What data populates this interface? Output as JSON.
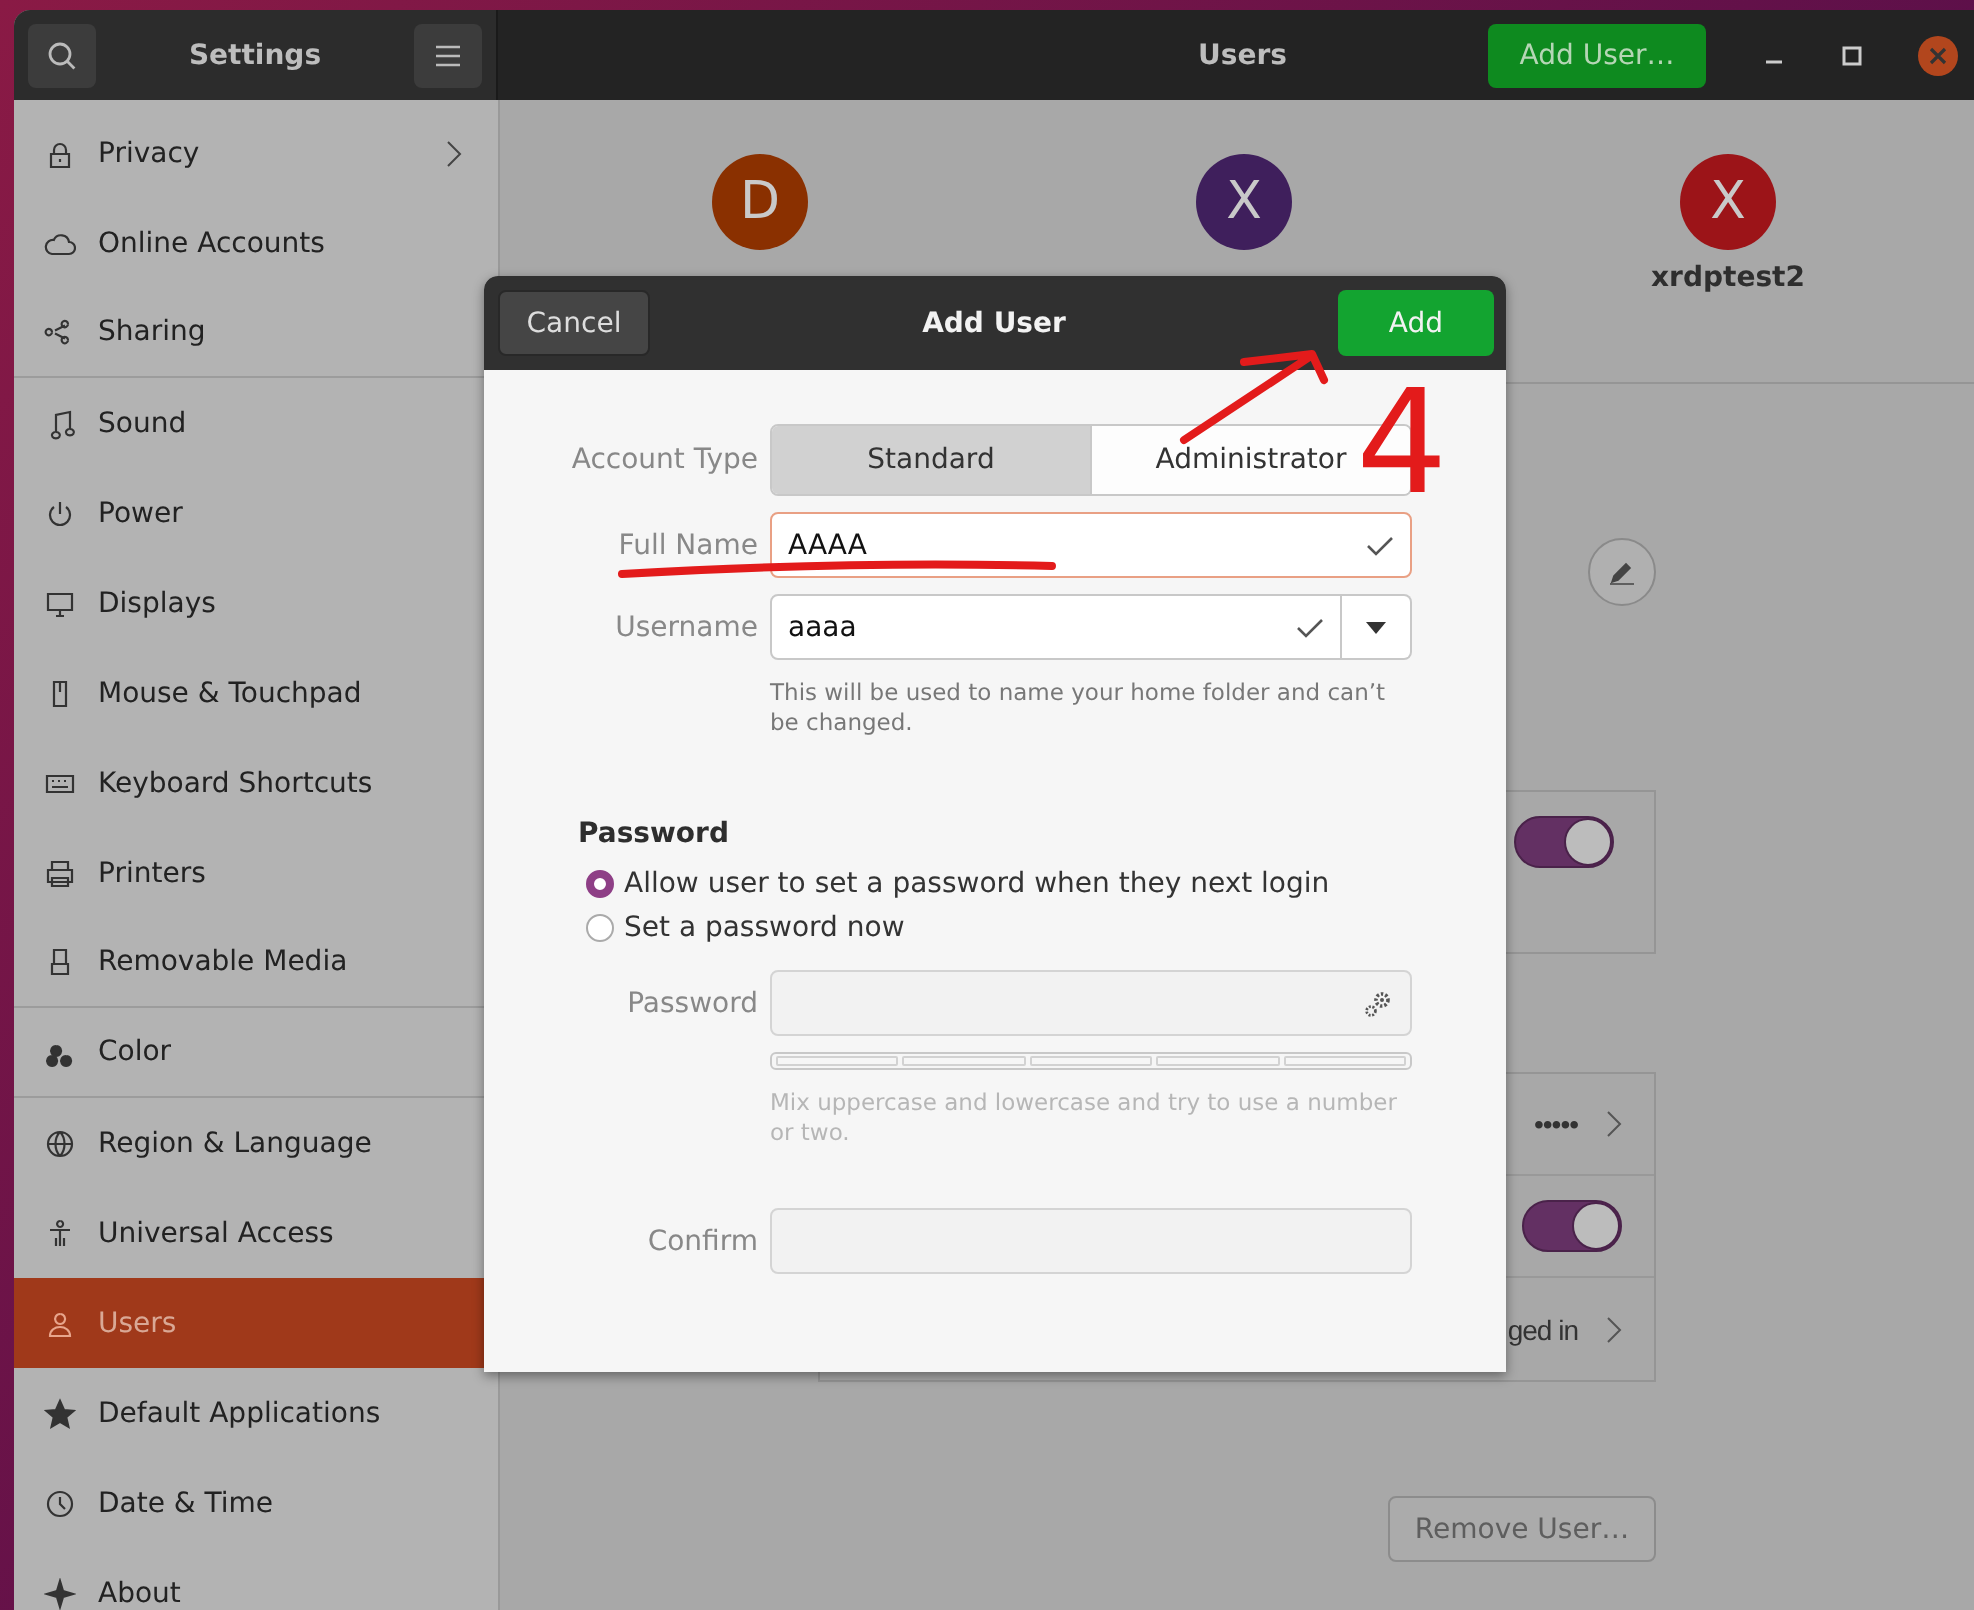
{
  "window": {
    "title": "Settings",
    "page_title": "Users",
    "add_user_button": "Add User…"
  },
  "sidebar": {
    "items": [
      {
        "label": "Privacy",
        "has_submenu": true,
        "group_end": false,
        "selected": false
      },
      {
        "label": "Online Accounts",
        "has_submenu": false,
        "group_end": false,
        "selected": false
      },
      {
        "label": "Sharing",
        "has_submenu": false,
        "group_end": true,
        "selected": false
      },
      {
        "label": "Sound",
        "has_submenu": false,
        "group_end": false,
        "selected": false
      },
      {
        "label": "Power",
        "has_submenu": false,
        "group_end": false,
        "selected": false
      },
      {
        "label": "Displays",
        "has_submenu": false,
        "group_end": false,
        "selected": false
      },
      {
        "label": "Mouse & Touchpad",
        "has_submenu": false,
        "group_end": false,
        "selected": false
      },
      {
        "label": "Keyboard Shortcuts",
        "has_submenu": false,
        "group_end": false,
        "selected": false
      },
      {
        "label": "Printers",
        "has_submenu": false,
        "group_end": false,
        "selected": false
      },
      {
        "label": "Removable Media",
        "has_submenu": false,
        "group_end": true,
        "selected": false
      },
      {
        "label": "Color",
        "has_submenu": false,
        "group_end": true,
        "selected": false
      },
      {
        "label": "Region & Language",
        "has_submenu": false,
        "group_end": false,
        "selected": false
      },
      {
        "label": "Universal Access",
        "has_submenu": false,
        "group_end": false,
        "selected": false
      },
      {
        "label": "Users",
        "has_submenu": false,
        "group_end": false,
        "selected": true
      },
      {
        "label": "Default Applications",
        "has_submenu": false,
        "group_end": false,
        "selected": false
      },
      {
        "label": "Date & Time",
        "has_submenu": false,
        "group_end": false,
        "selected": false
      },
      {
        "label": "About",
        "has_submenu": false,
        "group_end": false,
        "selected": false
      }
    ]
  },
  "users": [
    {
      "initial": "D",
      "color": "#8a3000"
    },
    {
      "initial": "X",
      "color": "#3f1f5c"
    },
    {
      "initial": "X",
      "color": "#9c1418",
      "name": "xrdptest2"
    }
  ],
  "account_panel": {
    "toggle_on": true
  },
  "login_panel": {
    "rows": [
      {
        "kind": "value",
        "text": "•••••"
      },
      {
        "kind": "toggle",
        "on": true
      },
      {
        "kind": "value",
        "text": "ged in"
      }
    ]
  },
  "remove_button": "Remove User…",
  "dialog": {
    "title": "Add User",
    "cancel": "Cancel",
    "confirm": "Add",
    "account_type": {
      "label": "Account Type",
      "options": [
        {
          "label": "Standard",
          "selected": true
        },
        {
          "label": "Administrator",
          "selected": false
        }
      ]
    },
    "full_name": {
      "label": "Full Name",
      "value": "AAAA",
      "valid": true,
      "focused": true
    },
    "username": {
      "label": "Username",
      "value": "aaaa",
      "valid": true,
      "focused": false,
      "hint": "This will be used to name your home folder and can’t be changed."
    },
    "password": {
      "heading": "Password",
      "options": [
        {
          "label": "Allow user to set a password when they next login",
          "selected": true
        },
        {
          "label": "Set a password now",
          "selected": false
        }
      ],
      "disabled": true,
      "field_label": "Password",
      "hint": "Mix uppercase and lowercase and try to use a number or two.",
      "confirm_label": "Confirm"
    }
  },
  "annotation": {
    "label": "4"
  }
}
